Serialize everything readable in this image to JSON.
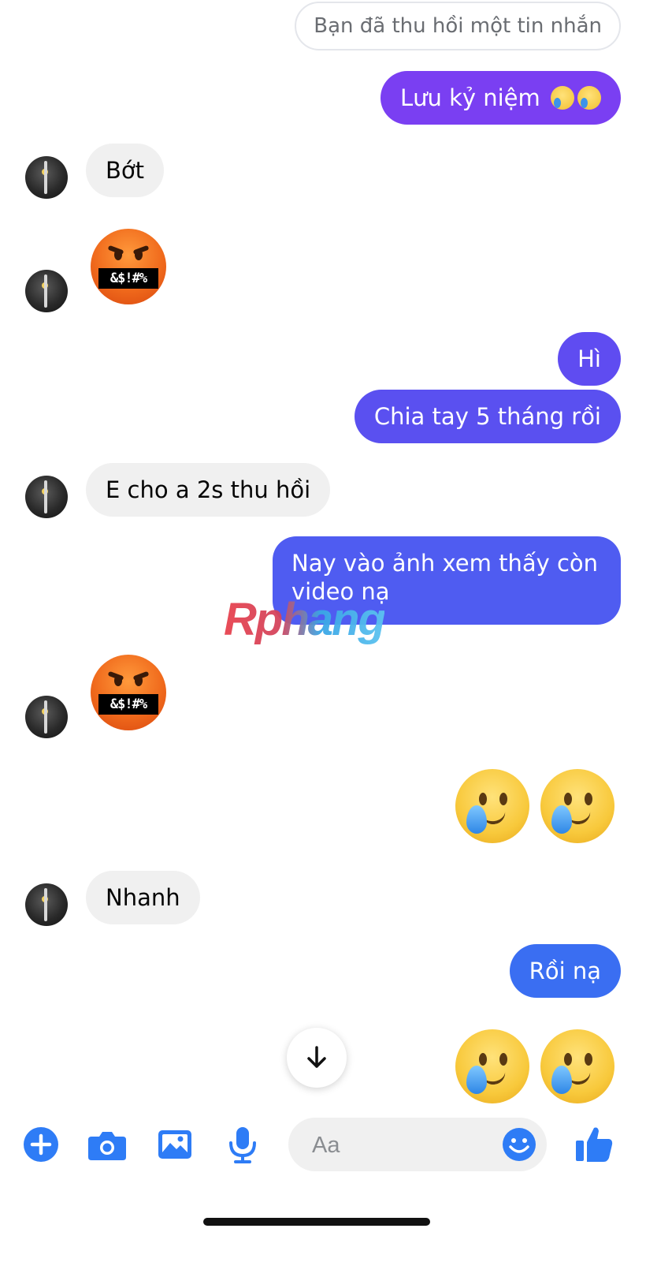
{
  "recalled_notice": "Bạn đã thu hồi một tin nhắn",
  "messages": {
    "m1": "Lưu kỷ niệm",
    "m2": "Bớt",
    "m3_angry_label": "&$!#%",
    "m4": "Hì",
    "m5": "Chia tay 5 tháng rồi",
    "m6": "E cho a 2s thu hồi",
    "m7_line1": "Nay vào ảnh xem thấy còn",
    "m7_line2": "video nạ",
    "m8_angry_label": "&$!#%",
    "m9": "Nhanh",
    "m10": "Rồi nạ"
  },
  "watermark": "Rphang",
  "composer": {
    "placeholder": "Aa"
  },
  "colors": {
    "outgoing_top": "#7b3ff2",
    "outgoing_mid": "#5a50f0",
    "outgoing_bottom": "#3a6ef2",
    "accent": "#2e7cf6"
  },
  "icons": [
    "plus-icon",
    "camera-icon",
    "image-icon",
    "microphone-icon",
    "emoji-icon",
    "like-icon",
    "arrow-down-icon"
  ]
}
